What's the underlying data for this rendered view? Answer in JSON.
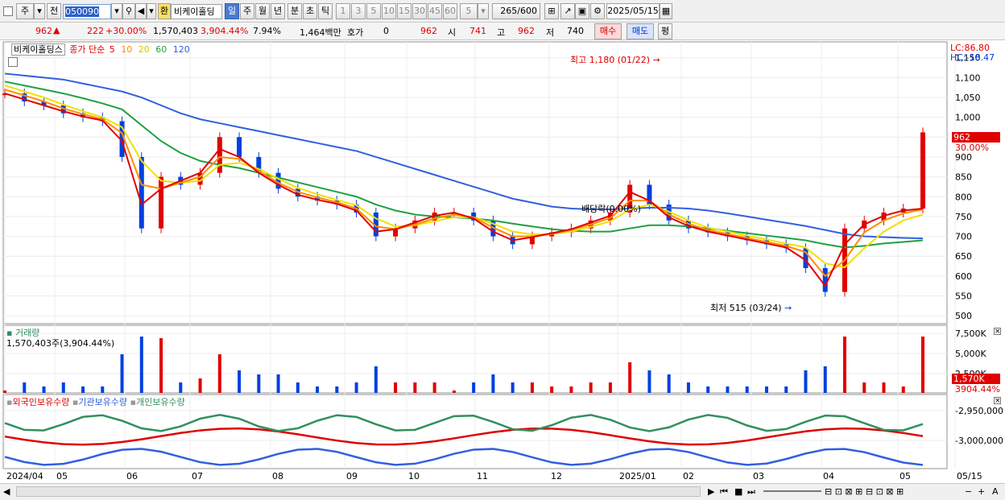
{
  "toolbar": {
    "period_type": "주",
    "prev_label": "전",
    "stock_code": "050090",
    "stock_prefix": "환",
    "stock_name": "비케이홀딩",
    "periods": [
      "일",
      "주",
      "월",
      "년",
      "분",
      "초",
      "틱"
    ],
    "active_period": "일",
    "intervals": [
      "1",
      "3",
      "5",
      "10",
      "15",
      "30",
      "45",
      "60"
    ],
    "interval_value": "5",
    "count_value": "265",
    "count_max": "/600",
    "date_value": "2025/05/15"
  },
  "quote": {
    "price": "962",
    "change": "222",
    "change_pct": "+30.00%",
    "volume": "1,570,403",
    "volume_pct": "3,904.44%",
    "turnover_pct": "7.94%",
    "amount": "1,464백만",
    "hoga_label": "호가",
    "hoga_value": "0",
    "ask": "962",
    "open_label": "시",
    "open": "741",
    "high_label": "고",
    "high": "962",
    "low_label": "저",
    "low": "740",
    "buy_button": "매수",
    "sell_button": "매도",
    "eval_button": "평"
  },
  "price_panel": {
    "stock_label": "비케이홀딩스",
    "ma_title": "종가 단순",
    "ma_periods": [
      {
        "label": "5",
        "color": "#e00000"
      },
      {
        "label": "10",
        "color": "#ff8c00"
      },
      {
        "label": "20",
        "color": "#f0e000"
      },
      {
        "label": "60",
        "color": "#20a040"
      },
      {
        "label": "120",
        "color": "#3060e0"
      }
    ],
    "lc": "LC:86.80",
    "hc": "HC:-18.47",
    "y_ticks": [
      "1,150",
      "1,100",
      "1,050",
      "1,000",
      "950",
      "900",
      "850",
      "800",
      "750",
      "700",
      "650",
      "600",
      "550",
      "500"
    ],
    "current_price_tag": "962",
    "current_pct_tag": "30.00%",
    "annotation_high": "최고 1,180 (01/22)",
    "annotation_low": "최저 515 (03/24)",
    "annotation_dividend": "배당락(0.00%)"
  },
  "volume_panel": {
    "title": "거래량",
    "value_label": "1,570,403주(3,904.44%)",
    "y_ticks": [
      "7,500K",
      "5,000K",
      "2,500K"
    ],
    "current_tag": "1,570K",
    "current_pct_tag": "3904.44%"
  },
  "holding_panel": {
    "series": [
      {
        "label": "외국인보유수량",
        "color": "#e00000"
      },
      {
        "label": "기관보유수량",
        "color": "#3060e0"
      },
      {
        "label": "개인보유수량",
        "color": "#309060"
      }
    ],
    "y_ticks": [
      "-2,950,000",
      "-3,000,000"
    ]
  },
  "x_axis": {
    "labels": [
      "2024/04",
      "05",
      "06",
      "07",
      "08",
      "09",
      "10",
      "11",
      "12",
      "2025/01",
      "02",
      "03",
      "04",
      "05",
      "05/15"
    ]
  },
  "chart_data": {
    "type": "line",
    "title": "",
    "ylabel": "",
    "ylim": [
      480,
      1190
    ],
    "series": [
      {
        "name": "종가",
        "values": [
          1060,
          1040,
          1030,
          1010,
          1000,
          990,
          900,
          720,
          850,
          830,
          860,
          950,
          900,
          860,
          820,
          800,
          790,
          780,
          760,
          700,
          720,
          740,
          760,
          760,
          740,
          700,
          680,
          700,
          710,
          720,
          740,
          760,
          830,
          780,
          740,
          720,
          710,
          700,
          690,
          680,
          670,
          620,
          560,
          720,
          740,
          760,
          770,
          962
        ]
      },
      {
        "name": "5",
        "values": [
          1060,
          1045,
          1030,
          1015,
          1002,
          992,
          940,
          780,
          820,
          840,
          860,
          920,
          900,
          860,
          830,
          805,
          792,
          782,
          765,
          712,
          718,
          735,
          752,
          760,
          745,
          712,
          690,
          698,
          708,
          718,
          735,
          752,
          812,
          790,
          748,
          726,
          712,
          702,
          692,
          682,
          672,
          640,
          575,
          680,
          730,
          752,
          765,
          770
        ]
      },
      {
        "name": "10",
        "values": [
          1070,
          1055,
          1040,
          1022,
          1008,
          995,
          960,
          830,
          820,
          835,
          850,
          900,
          895,
          865,
          835,
          812,
          798,
          786,
          770,
          725,
          718,
          730,
          745,
          755,
          748,
          722,
          700,
          700,
          706,
          716,
          730,
          746,
          790,
          790,
          755,
          732,
          716,
          706,
          696,
          686,
          676,
          660,
          600,
          640,
          710,
          740,
          758,
          768
        ]
      },
      {
        "name": "20",
        "values": [
          1080,
          1065,
          1050,
          1032,
          1015,
          1000,
          975,
          890,
          840,
          835,
          840,
          880,
          885,
          870,
          845,
          822,
          806,
          792,
          778,
          745,
          725,
          728,
          738,
          748,
          748,
          732,
          712,
          705,
          706,
          712,
          724,
          738,
          768,
          780,
          762,
          740,
          722,
          712,
          702,
          692,
          682,
          672,
          632,
          622,
          670,
          712,
          740,
          755
        ]
      },
      {
        "name": "60",
        "values": [
          1090,
          1080,
          1070,
          1060,
          1048,
          1035,
          1020,
          980,
          940,
          910,
          890,
          880,
          872,
          860,
          848,
          836,
          824,
          812,
          800,
          780,
          765,
          755,
          750,
          748,
          745,
          740,
          732,
          725,
          718,
          714,
          712,
          712,
          720,
          728,
          728,
          725,
          720,
          714,
          708,
          702,
          696,
          690,
          680,
          672,
          676,
          682,
          686,
          690
        ]
      },
      {
        "name": "120",
        "values": [
          1110,
          1105,
          1100,
          1095,
          1085,
          1075,
          1065,
          1050,
          1030,
          1010,
          995,
          985,
          975,
          965,
          955,
          945,
          935,
          925,
          915,
          900,
          885,
          870,
          855,
          840,
          825,
          810,
          795,
          785,
          775,
          770,
          768,
          768,
          770,
          772,
          772,
          770,
          765,
          758,
          750,
          742,
          734,
          726,
          716,
          706,
          700,
          698,
          696,
          695
        ]
      }
    ]
  }
}
